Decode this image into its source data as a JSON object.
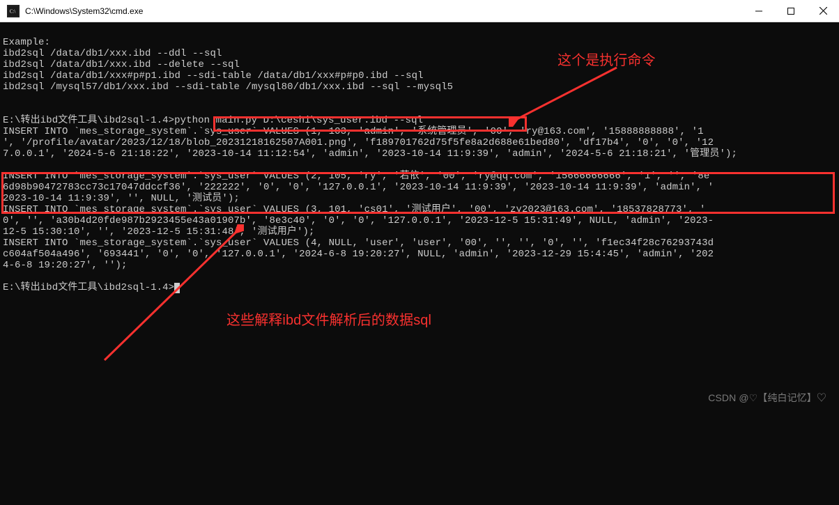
{
  "titlebar": {
    "title": "C:\\Windows\\System32\\cmd.exe"
  },
  "terminal": {
    "lines": [
      "Example:",
      "ibd2sql /data/db1/xxx.ibd --ddl --sql",
      "ibd2sql /data/db1/xxx.ibd --delete --sql",
      "ibd2sql /data/db1/xxx#p#p1.ibd --sdi-table /data/db1/xxx#p#p0.ibd --sql",
      "ibd2sql /mysql57/db1/xxx.ibd --sdi-table /mysql80/db1/xxx.ibd --sql --mysql5",
      "",
      "",
      "E:\\转出ibd文件工具\\ibd2sql-1.4>python main.py D:\\ceshi\\sys_user.ibd --sql",
      "INSERT INTO `mes_storage_system`.`sys_user` VALUES (1, 103, 'admin', '系统管理员', '00', 'ry@163.com', '15888888888', '1",
      "', '/profile/avatar/2023/12/18/blob_20231218162507A001.png', 'f189701762d75f5fe8a2d688e61bed80', 'df17b4', '0', '0', '12",
      "7.0.0.1', '2024-5-6 21:18:22', '2023-10-14 11:12:54', 'admin', '2023-10-14 11:9:39', 'admin', '2024-5-6 21:18:21', '管理员');",
      "",
      "INSERT INTO `mes_storage_system`.`sys_user` VALUES (2, 105, 'ry', '若依', '00', 'ry@qq.com', '15666666666', '1', '', '8e",
      "6d98b90472783cc73c17047ddccf36', '222222', '0', '0', '127.0.0.1', '2023-10-14 11:9:39', '2023-10-14 11:9:39', 'admin', '",
      "2023-10-14 11:9:39', '', NULL, '测试员');",
      "INSERT INTO `mes_storage_system`.`sys_user` VALUES (3, 101, 'cs01', '测试用户', '00', 'zy2023@163.com', '18537828773', '",
      "0', '', 'a30b4d20fde987b2923455e43a01907b', '8e3c40', '0', '0', '127.0.0.1', '2023-12-5 15:31:49', NULL, 'admin', '2023-",
      "12-5 15:30:10', '', '2023-12-5 15:31:48', '测试用户');",
      "INSERT INTO `mes_storage_system`.`sys_user` VALUES (4, NULL, 'user', 'user', '00', '', '', '0', '', 'f1ec34f28c76293743d",
      "c604af504a496', '693441', '0', '0', '127.0.0.1', '2024-6-8 19:20:27', NULL, 'admin', '2023-12-29 15:4:45', 'admin', '202",
      "4-6-8 19:20:27', '');",
      "",
      "E:\\转出ibd文件工具\\ibd2sql-1.4>"
    ]
  },
  "annotations": {
    "cmd_label": "这个是执行命令",
    "sql_label": "这些解释ibd文件解析后的数据sql"
  },
  "watermark": "CSDN @♡【纯白记忆】♡"
}
